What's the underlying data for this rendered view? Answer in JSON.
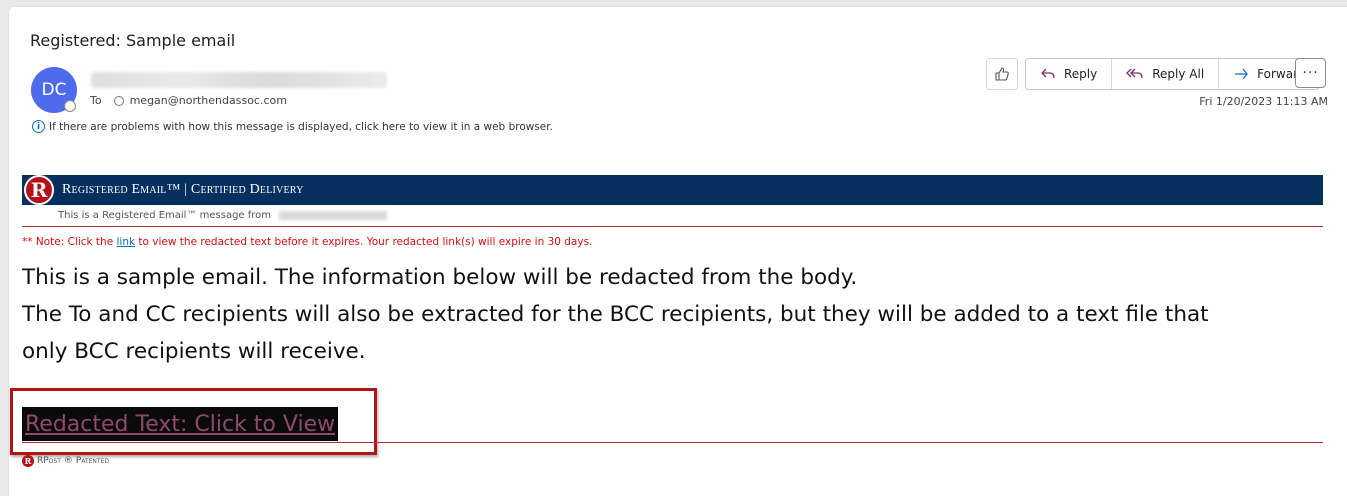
{
  "subject": "Registered: Sample email",
  "sender": {
    "initials": "DC"
  },
  "recipients": {
    "to_label": "To",
    "address": "megan@northendassoc.com"
  },
  "info_bar": "If there are problems with how this message is displayed, click here to view it in a web browser.",
  "actions": {
    "reply": "Reply",
    "reply_all": "Reply All",
    "forward": "Forward",
    "more": "···"
  },
  "date": "Fri 1/20/2023 11:13 AM",
  "banner": {
    "title": "Registered Email™ | Certified Delivery",
    "logo_letter": "R",
    "subtitle": "This is a Registered Email™ message from"
  },
  "note": {
    "prefix": "** Note: Click the ",
    "link": "link",
    "suffix": " to view the redacted text before it expires. Your redacted link(s) will expire in 30 days."
  },
  "body": {
    "line1": "This is a sample email. The information below will be redacted from the body.",
    "line2": "The To and CC recipients will also be extracted for the BCC recipients, but they will be added to a text file that",
    "line3": "only BCC recipients will receive."
  },
  "redacted_link": "Redacted Text: Click to View",
  "footer": {
    "logo_letter": "R",
    "brand": "RPost",
    "mark": "®",
    "patented": "Patented"
  },
  "colors": {
    "banner": "#052f5f",
    "accent_red": "#b01417",
    "avatar": "#4f6bed",
    "link": "#0f6cbd"
  }
}
